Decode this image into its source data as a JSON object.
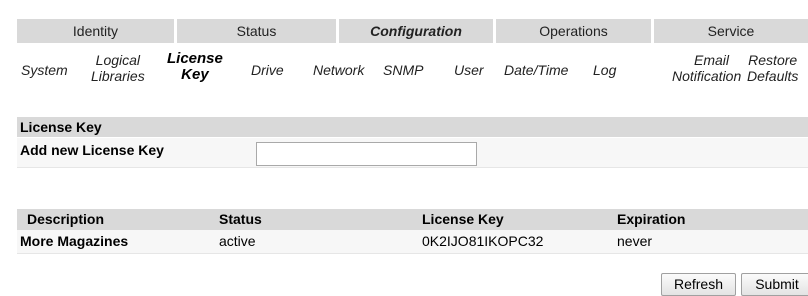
{
  "top_tabs": [
    {
      "label": "Identity",
      "active": false
    },
    {
      "label": "Status",
      "active": false
    },
    {
      "label": "Configuration",
      "active": true
    },
    {
      "label": "Operations",
      "active": false
    },
    {
      "label": "Service",
      "active": false
    }
  ],
  "sub_nav": [
    {
      "label": "System"
    },
    {
      "label_line1": "Logical",
      "label_line2": "Libraries"
    },
    {
      "label_line1": "License",
      "label_line2": "Key",
      "active": true
    },
    {
      "label": "Drive"
    },
    {
      "label": "Network"
    },
    {
      "label": "SNMP"
    },
    {
      "label": "User"
    },
    {
      "label": "Date/Time"
    },
    {
      "label": "Log"
    },
    {
      "label_line1": "Email",
      "label_line2": "Notification"
    },
    {
      "label_line1": "Restore",
      "label_line2": "Defaults"
    }
  ],
  "license_section": {
    "title": "License Key",
    "add_label": "Add new License Key",
    "input_value": ""
  },
  "license_table": {
    "columns": [
      "Description",
      "Status",
      "License Key",
      "Expiration"
    ],
    "rows": [
      {
        "description": "More Magazines",
        "status": "active",
        "license_key": "0K2IJO81IKOPC32",
        "expiration": "never"
      }
    ]
  },
  "buttons": {
    "refresh_label": "Refresh",
    "submit_label": "Submit"
  }
}
